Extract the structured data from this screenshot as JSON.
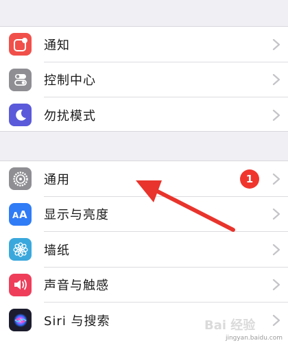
{
  "group1": {
    "items": [
      {
        "label": "通知",
        "icon": "notification-icon",
        "color": "#f1504a"
      },
      {
        "label": "控制中心",
        "icon": "control-center-icon",
        "color": "#8e8e93"
      },
      {
        "label": "勿扰模式",
        "icon": "moon-icon",
        "color": "#5a5adb"
      }
    ]
  },
  "group2": {
    "items": [
      {
        "label": "通用",
        "icon": "gear-icon",
        "color": "#8e8e93",
        "badge": "1"
      },
      {
        "label": "显示与亮度",
        "icon": "display-brightness-icon",
        "color": "#2f7cf6"
      },
      {
        "label": "墙纸",
        "icon": "wallpaper-flower-icon",
        "color": "#3aa8dc"
      },
      {
        "label": "声音与触感",
        "icon": "speaker-icon",
        "color": "#ef3e5a"
      },
      {
        "label": "Siri 与搜索",
        "icon": "siri-icon",
        "color": "#1c1c2e"
      }
    ]
  },
  "colors": {
    "badge": "#f0352d",
    "annotation_arrow": "#e8342c",
    "background": "#efeff4"
  },
  "watermark": {
    "brand": "Bai 经验",
    "url": "jingyan.baidu.com"
  }
}
